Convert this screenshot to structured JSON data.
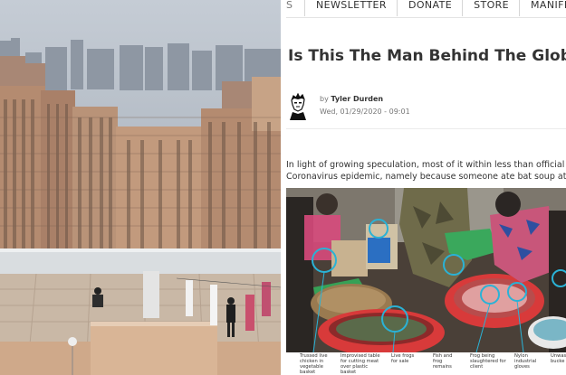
{
  "nav": {
    "items": [
      "S",
      "NEWSLETTER",
      "DONATE",
      "STORE",
      "MANIFESTO"
    ]
  },
  "article": {
    "headline": "Is This The Man Behind The Global C",
    "byline_prefix": "by",
    "author": "Tyler Durden",
    "date": "Wed, 01/29/2020 - 09:01",
    "body_line1": "In light of growing speculation, most of it within less than official ci",
    "body_line2": "Coronavirus epidemic, namely because someone ate bat soup at a W"
  },
  "captions": [
    "Trussed live chicken in vegetable basket",
    "Improvised table for cutting meat over plastic basket",
    "Live frogs for sale",
    "Fish and frog remains",
    "Frog being slaughtered for client",
    "Nylon industrial gloves",
    "Unwas bucke"
  ],
  "colors": {
    "sky": "#aeb7c2",
    "building": "#b78f73",
    "annotation_circle": "#2ab2d6",
    "basin_red": "#d83a3a"
  },
  "icons": {
    "avatar": "tyler-durden-avatar-icon"
  }
}
